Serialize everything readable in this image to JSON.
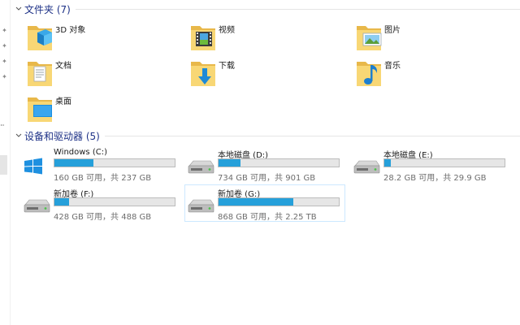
{
  "colors": {
    "header_text": "#1e3287",
    "bar_fill": "#26a0da",
    "bar_track": "#e6e6e6",
    "folder_yellow": "#f8d775"
  },
  "folders_group": {
    "title": "文件夹 (7)",
    "items": [
      {
        "label": "3D 对象",
        "icon": "3d-objects-folder-icon"
      },
      {
        "label": "视频",
        "icon": "videos-folder-icon"
      },
      {
        "label": "图片",
        "icon": "pictures-folder-icon"
      },
      {
        "label": "文档",
        "icon": "documents-folder-icon"
      },
      {
        "label": "下载",
        "icon": "downloads-folder-icon"
      },
      {
        "label": "音乐",
        "icon": "music-folder-icon"
      },
      {
        "label": "桌面",
        "icon": "desktop-folder-icon"
      }
    ]
  },
  "drives_group": {
    "title": "设备和驱动器 (5)",
    "items": [
      {
        "name": "Windows (C:)",
        "space": "160 GB 可用，共 237 GB",
        "used_fraction": 0.325,
        "icon": "windows-drive-icon",
        "selected": false
      },
      {
        "name": "本地磁盘 (D:)",
        "space": "734 GB 可用，共 901 GB",
        "used_fraction": 0.185,
        "icon": "hard-drive-icon",
        "selected": false
      },
      {
        "name": "本地磁盘 (E:)",
        "space": "28.2 GB 可用，共 29.9 GB",
        "used_fraction": 0.057,
        "icon": "hard-drive-icon",
        "selected": false
      },
      {
        "name": "新加卷 (F:)",
        "space": "428 GB 可用，共 488 GB",
        "used_fraction": 0.123,
        "icon": "hard-drive-icon",
        "selected": false
      },
      {
        "name": "新加卷 (G:)",
        "space": "868 GB 可用，共 2.25 TB",
        "used_fraction": 0.623,
        "icon": "hard-drive-icon",
        "selected": true
      }
    ]
  }
}
